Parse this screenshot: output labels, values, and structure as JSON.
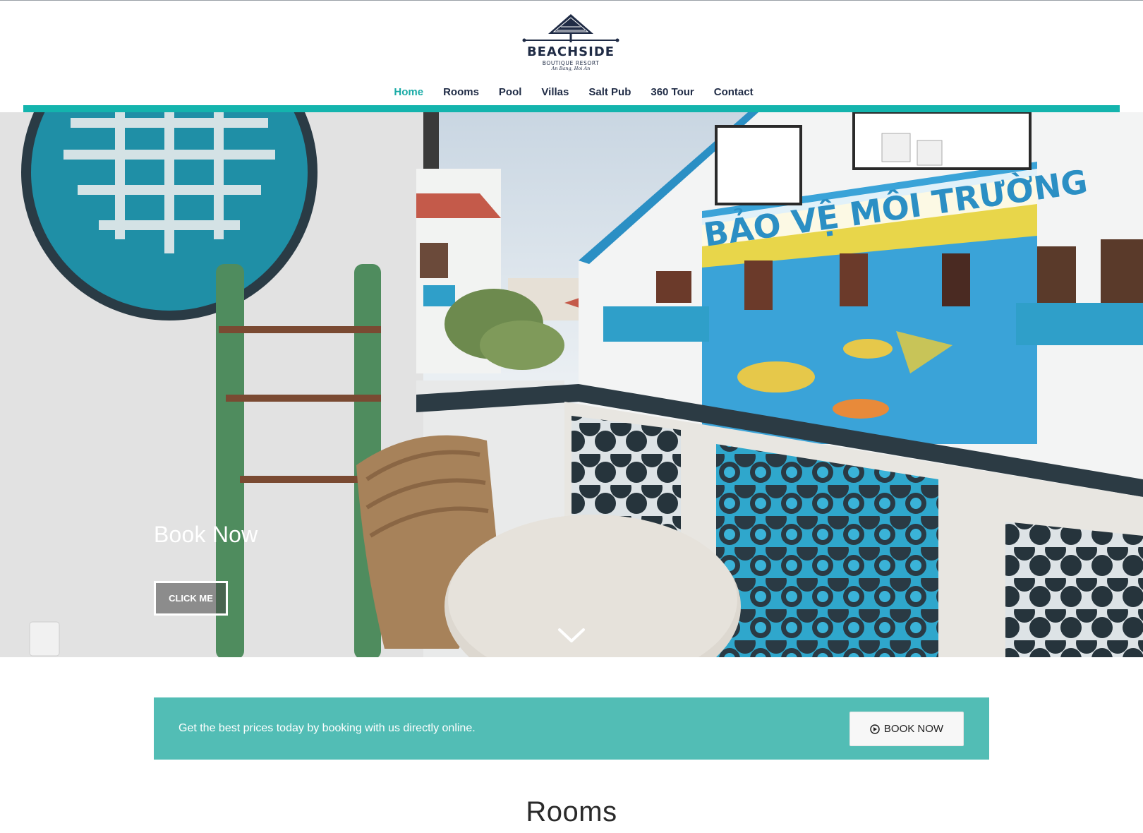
{
  "brand": {
    "name": "BEACHSIDE",
    "tagline": "BOUTIQUE RESORT",
    "location": "An Bang, Hoi An",
    "colors": {
      "navy": "#1f2b45",
      "teal": "#14b4ad",
      "promo_teal": "#52bdb5"
    }
  },
  "nav": {
    "items": [
      {
        "label": "Home",
        "active": true
      },
      {
        "label": "Rooms",
        "active": false
      },
      {
        "label": "Pool",
        "active": false
      },
      {
        "label": "Villas",
        "active": false
      },
      {
        "label": "Salt Pub",
        "active": false
      },
      {
        "label": "360 Tour",
        "active": false
      },
      {
        "label": "Contact",
        "active": false
      }
    ]
  },
  "hero": {
    "title": "Book Now",
    "button_label": "CLICK ME",
    "mural_text": "BẢO VỆ MÔI TRƯỜNG",
    "scroll_icon": "chevron-down-icon"
  },
  "promo": {
    "text": "Get the best prices today by booking with us directly online.",
    "button_label": "BOOK NOW",
    "button_icon": "arrow-circle-right-icon"
  },
  "section": {
    "title": "Rooms"
  }
}
